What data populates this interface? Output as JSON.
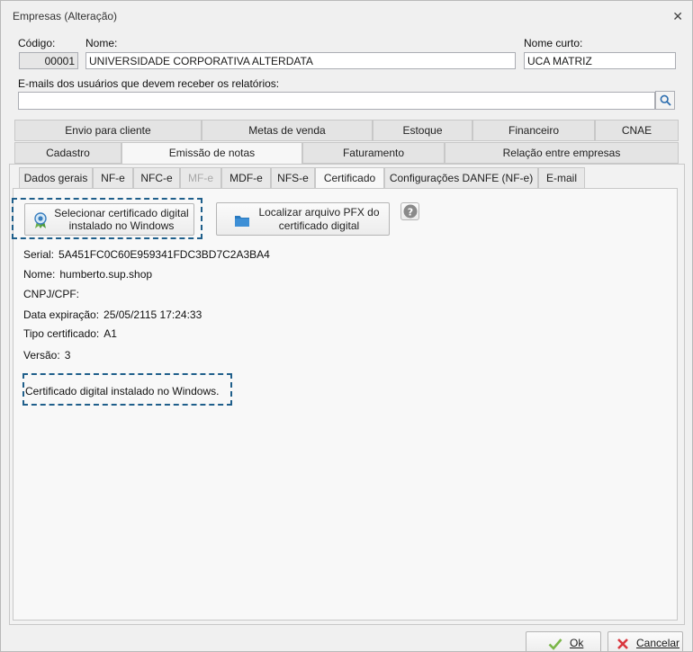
{
  "window": {
    "title": "Empresas (Alteração)",
    "close_symbol": "✕"
  },
  "form": {
    "codigo_label": "Código:",
    "codigo_value": "00001",
    "nome_label": "Nome:",
    "nome_value": "UNIVERSIDADE CORPORATIVA ALTERDATA",
    "nome_curto_label": "Nome curto:",
    "nome_curto_value": "UCA MATRIZ",
    "emails_label": "E-mails dos usuários que devem receber os relatórios:",
    "emails_value": ""
  },
  "tabs_row1": [
    "Envio para cliente",
    "Metas de venda",
    "Estoque",
    "Financeiro",
    "CNAE"
  ],
  "tabs_row2": [
    "Cadastro",
    "Emissão de notas",
    "Faturamento",
    "Relação entre empresas"
  ],
  "subtabs": [
    "Dados gerais",
    "NF-e",
    "NFC-e",
    "MF-e",
    "MDF-e",
    "NFS-e",
    "Certificado",
    "Configurações DANFE (NF-e)",
    "E-mail"
  ],
  "buttons": {
    "select_cert_line1": "Selecionar certificado digital",
    "select_cert_line2": "instalado no Windows",
    "locate_pfx_line1": "Localizar arquivo PFX do",
    "locate_pfx_line2": "certificado digital",
    "help_symbol": "?"
  },
  "certificate": {
    "serial_label": "Serial:",
    "serial_value": "5A451FC0C60E959341FDC3BD7C2A3BA4",
    "nome_label": "Nome:",
    "nome_value": "humberto.sup.shop",
    "cnpj_label": "CNPJ/CPF:",
    "cnpj_value": "",
    "expiracao_label": "Data expiração:",
    "expiracao_value": "25/05/2115 17:24:33",
    "tipo_label": "Tipo certificado:",
    "tipo_value": "A1",
    "versao_label": "Versão:",
    "versao_value": "3",
    "status_message": "Certificado digital instalado no Windows."
  },
  "footer": {
    "ok_label": "Ok",
    "cancel_label": "Cancelar"
  },
  "colors": {
    "highlight_dash": "#1f5f8b",
    "ok_check": "#7ab648",
    "cancel_x": "#d9363e",
    "folder": "#2a7ac0"
  }
}
